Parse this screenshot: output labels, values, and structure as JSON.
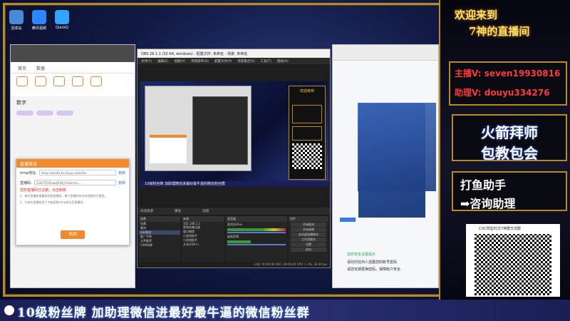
{
  "desktop": {
    "icons": [
      {
        "label": "回收站",
        "color": "#4a88d8"
      },
      {
        "label": "腾讯视频",
        "color": "#2e86ff"
      },
      {
        "label": "QuickQ",
        "color": "#33a3ff"
      }
    ]
  },
  "left_app": {
    "nav": [
      "首页",
      "数据"
    ],
    "section_title": "数字",
    "dialog": {
      "title": "直播推流",
      "server_label": "rtmp地址:",
      "server_value": "rtmp://sendtc3a.douyu.com/live",
      "server_copy": "复制",
      "key_label": "直播码:",
      "key_value": "2342791Dvwqf4lDj?txSecret=...",
      "key_copy": "复制",
      "warning": "您的直播码已过期，点击刷新",
      "notes": [
        "1、每次直播前请重新获取直播码，每个直播码仅在有效期内可使用。",
        "2、只有在直播状态下才能获取rtmp地址及直播码。"
      ],
      "ok_label": "关闭"
    }
  },
  "obs": {
    "title": "OBS 26.1.1 (32-64, windows) - 配置文件: 未命名 - 场景: 未命名",
    "menu": [
      "文件(F)",
      "编辑(E)",
      "视图(V)",
      "停靠部件(D)",
      "配置文件(P)",
      "场景集合(S)",
      "工具(T)",
      "帮助(H)"
    ],
    "preview_banner": "10级粉丝牌 加助理微信进最好最牛逼的微信粉丝群",
    "source_status": "未选择源",
    "properties_label": "属性",
    "filters_label": "滤镜",
    "panels": {
      "scenes_header": "场景",
      "scenes": [
        "场景",
        "素材",
        "obs推流",
        "推广中转",
        "大师推荐",
        "CAM场景"
      ],
      "sources_header": "来源",
      "sources": [
        "192.168.1.1",
        "视频采集设备",
        "窗口捕获",
        "小游戏助手",
        "小游戏助手",
        "文本(GDI+)"
      ],
      "mixer_header": "混音器",
      "mixer": [
        "麦克风/Aux",
        "桌面音频"
      ],
      "controls_header": "控件",
      "controls": [
        "开始推流",
        "开始录制",
        "启动虚拟摄像机",
        "工作室模式",
        "设置",
        "退出"
      ],
      "status": "LIVE: 00:00:00  REC: 00:00:00  CPU: 1.3%, 30.00 fps"
    }
  },
  "right_app": {
    "security_title": "您的安全设置提示",
    "notes": [
      "请勿向任何人透露您的账号密码",
      "请您定期更换密码，保障账户安全"
    ]
  },
  "overlay": {
    "welcome": "欢迎来到",
    "channel": "7神的直播间",
    "host_line": "主播V: seven19930816",
    "assistant_line": "助理V: douyu334276",
    "promo1_line1": "火箭拜师",
    "promo1_line2": "包教包会",
    "promo2_line1": "打鱼助手",
    "promo2_line2": "➡咨询助理",
    "qr_caption": "COC阵型村法7神群交流群",
    "ticker": "10级粉丝牌 加助理微信进最好最牛逼的微信粉丝群",
    "colors": {
      "gold": "#b58a2d",
      "red_text": "#ff3a3a",
      "white": "#ffffff"
    }
  }
}
